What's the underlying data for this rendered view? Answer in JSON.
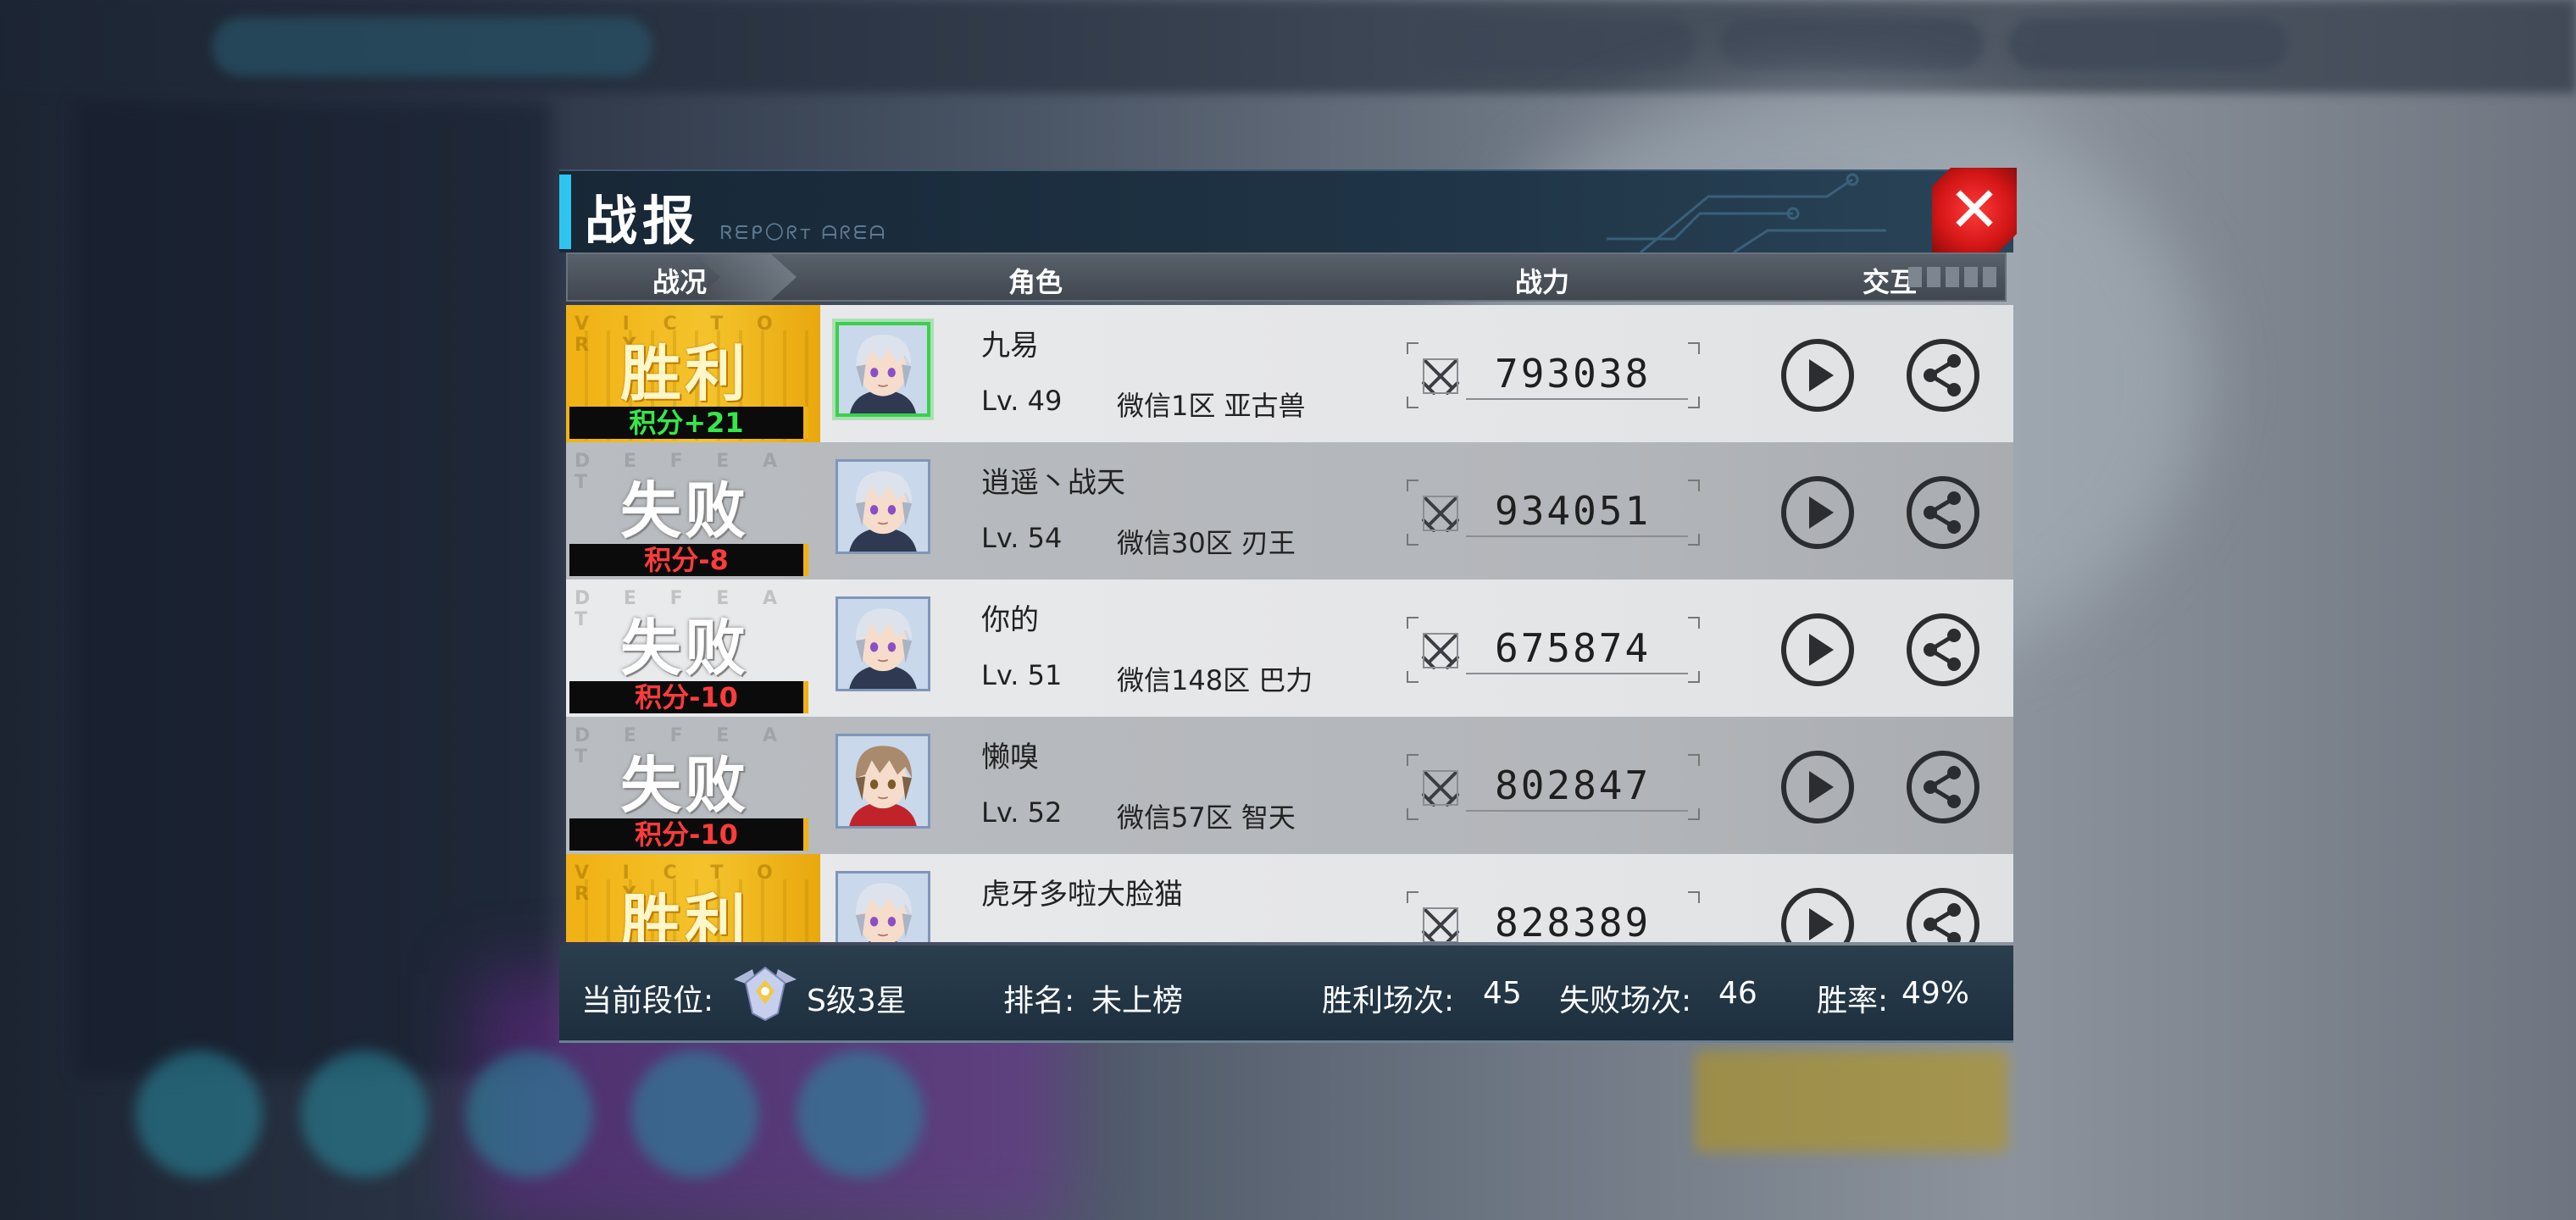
{
  "dialog": {
    "title": "战报",
    "subtitle_glyphs": "Ꮢᗴᑭ〇ᖇᴛ ᗩᖇᗴᗩ",
    "close_label": "✕"
  },
  "columns": {
    "status": "战况",
    "role": "角色",
    "power": "战力",
    "interact": "交互"
  },
  "result_watermarks": {
    "win": "V I C T O R Y",
    "lose": "D E F E A T"
  },
  "matches": [
    {
      "result": "胜利",
      "win": true,
      "score": "积分+21",
      "name": "九易",
      "level": "Lv. 49",
      "server": "微信1区 亚古兽",
      "power": "793038",
      "avatar": "silver-hair-avatar",
      "selected": true
    },
    {
      "result": "失败",
      "win": false,
      "score": "积分-8",
      "name": "逍遥丶战天",
      "level": "Lv. 54",
      "server": "微信30区 刃王",
      "power": "934051",
      "avatar": "silver-hair-avatar",
      "selected": false
    },
    {
      "result": "失败",
      "win": false,
      "score": "积分-10",
      "name": "你的",
      "level": "Lv. 51",
      "server": "微信148区 巴力",
      "power": "675874",
      "avatar": "silver-hair-avatar",
      "selected": false
    },
    {
      "result": "失败",
      "win": false,
      "score": "积分-10",
      "name": "懒嗅",
      "level": "Lv. 52",
      "server": "微信57区 智天",
      "power": "802847",
      "avatar": "brown-hair-avatar",
      "selected": false
    },
    {
      "result": "胜利",
      "win": true,
      "score": "",
      "name": "虎牙多啦大脸猫",
      "level": "",
      "server": "",
      "power": "828389",
      "avatar": "silver-hair-avatar",
      "selected": false
    }
  ],
  "footer": {
    "rank_label": "当前段位:",
    "rank_value": "S级3星",
    "ranking_label": "排名:",
    "ranking_value": "未上榜",
    "wins_label": "胜利场次:",
    "wins_value": "45",
    "losses_label": "失败场次:",
    "losses_value": "46",
    "winrate_label": "胜率:",
    "winrate_value": "49%"
  },
  "colors": {
    "accent": "#2ec4ef",
    "win_gold": "#f0b114",
    "win_score": "#37e64a",
    "lose_score": "#ff3b3b",
    "close_red": "#d41616"
  }
}
